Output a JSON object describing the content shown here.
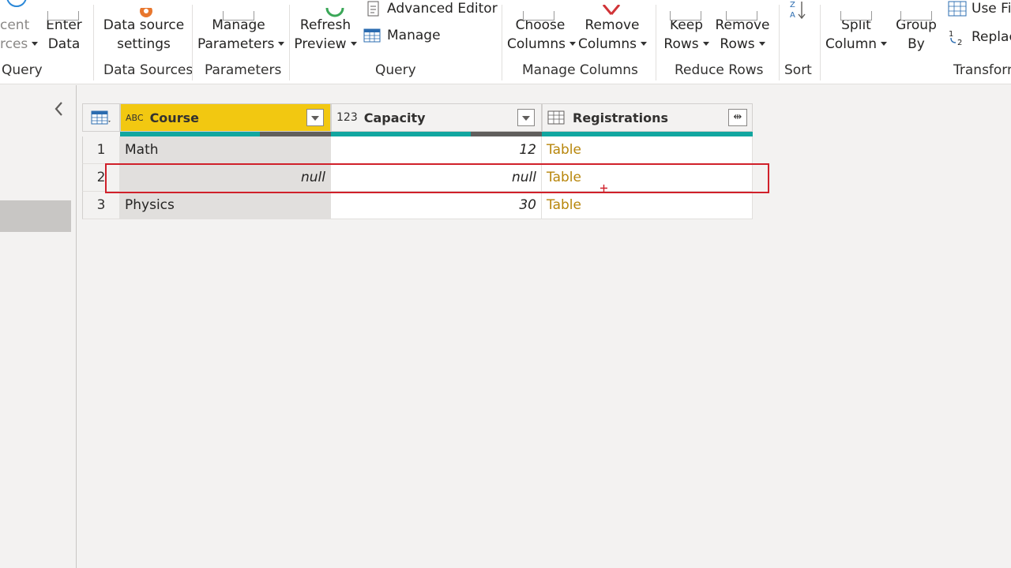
{
  "ribbon": {
    "recent_sources": {
      "line1": "cent",
      "line2": "rces"
    },
    "enter_data": {
      "line1": "Enter",
      "line2": "Data"
    },
    "data_source_settings": {
      "line1": "Data source",
      "line2": "settings"
    },
    "manage_parameters": {
      "line1": "Manage",
      "line2": "Parameters"
    },
    "refresh_preview": {
      "line1": "Refresh",
      "line2": "Preview"
    },
    "advanced_editor": "Advanced Editor",
    "manage": "Manage",
    "choose_columns": {
      "line1": "Choose",
      "line2": "Columns"
    },
    "remove_columns": {
      "line1": "Remove",
      "line2": "Columns"
    },
    "keep_rows": {
      "line1": "Keep",
      "line2": "Rows"
    },
    "remove_rows": {
      "line1": "Remove",
      "line2": "Rows"
    },
    "split_column": {
      "line1": "Split",
      "line2": "Column"
    },
    "group_by": {
      "line1": "Group",
      "line2": "By"
    },
    "use_first_row": "Use Fi",
    "replace_values": "Replac",
    "groups": {
      "query_left": "Query",
      "data_sources": "Data Sources",
      "parameters": "Parameters",
      "query": "Query",
      "manage_columns": "Manage Columns",
      "reduce_rows": "Reduce Rows",
      "sort": "Sort",
      "transform": "Transform"
    }
  },
  "grid": {
    "columns": [
      {
        "name": "Course",
        "type_icon": "text-type-icon",
        "type_label": "ABC",
        "active": true
      },
      {
        "name": "Capacity",
        "type_icon": "number-type-icon",
        "type_label": "123",
        "active": false
      },
      {
        "name": "Registrations",
        "type_icon": "table-type-icon",
        "type_label": "",
        "active": false
      }
    ],
    "rows": [
      {
        "num": "1",
        "course": "Math",
        "capacity": "12",
        "registrations": "Table"
      },
      {
        "num": "2",
        "course": "null",
        "capacity": "null",
        "registrations": "Table"
      },
      {
        "num": "3",
        "course": "Physics",
        "capacity": "30",
        "registrations": "Table"
      }
    ]
  },
  "colors": {
    "active_header": "#f2c811",
    "quality_ok": "#11a6a0",
    "highlight": "#d0202a",
    "table_link": "#b8860b"
  }
}
